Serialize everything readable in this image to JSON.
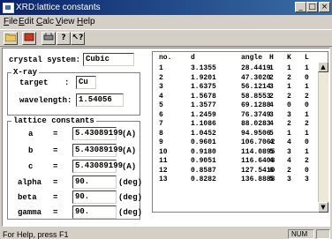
{
  "window": {
    "title": "XRD:lattice constants",
    "controls": [
      "minimize",
      "maximize",
      "close"
    ]
  },
  "menu": [
    "File",
    "Edit",
    "Calc",
    "View",
    "Help"
  ],
  "toolbar": {
    "buttons": [
      "folder-icon",
      "book-icon",
      "print-icon",
      "help-icon",
      "context-help-icon"
    ]
  },
  "crystal": {
    "label": "crystal system:",
    "value": "Cubic"
  },
  "xray": {
    "group_label": "X-ray",
    "target_label": "target",
    "target_colon": ":",
    "target_value": "Cu",
    "wavelength_label": "wavelength:",
    "wavelength_value": "1.54056"
  },
  "lattice": {
    "group_label": "lattice constants",
    "a_label": "a",
    "a_value": "5.43089199",
    "a_unit": "(A)",
    "b_label": "b",
    "b_value": "5.43089199",
    "b_unit": "(A)",
    "c_label": "c",
    "c_value": "5.43089199",
    "c_unit": "(A)",
    "alpha_label": "alpha",
    "alpha_value": "90.",
    "alpha_unit": "(deg)",
    "beta_label": "beta",
    "beta_value": "90.",
    "beta_unit": "(deg)",
    "gamma_label": "gamma",
    "gamma_value": "90.",
    "gamma_unit": "(deg)",
    "eq": "="
  },
  "table": {
    "headers": [
      "no.",
      "d",
      "angle",
      "H",
      "K",
      "L"
    ],
    "rows": [
      [
        "1",
        "3.1355",
        "28.4419",
        "1",
        "1",
        "1"
      ],
      [
        "2",
        "1.9201",
        "47.3020",
        "2",
        "2",
        "0"
      ],
      [
        "3",
        "1.6375",
        "56.1214",
        "3",
        "1",
        "1"
      ],
      [
        "4",
        "1.5678",
        "58.8553",
        "2",
        "2",
        "2"
      ],
      [
        "5",
        "1.3577",
        "69.1288",
        "4",
        "0",
        "0"
      ],
      [
        "6",
        "1.2459",
        "76.3749",
        "3",
        "3",
        "1"
      ],
      [
        "7",
        "1.1086",
        "88.0283",
        "4",
        "2",
        "2"
      ],
      [
        "8",
        "1.0452",
        "94.9506",
        "5",
        "1",
        "1"
      ],
      [
        "9",
        "0.9601",
        "106.7062",
        "4",
        "4",
        "0"
      ],
      [
        "10",
        "0.9180",
        "114.0895",
        "5",
        "3",
        "1"
      ],
      [
        "11",
        "0.9051",
        "116.6408",
        "4",
        "4",
        "2"
      ],
      [
        "12",
        "0.8587",
        "127.5410",
        "6",
        "2",
        "0"
      ],
      [
        "13",
        "0.8282",
        "136.8888",
        "5",
        "3",
        "3"
      ]
    ]
  },
  "status": {
    "help": "For Help, press F1",
    "num": "NUM"
  }
}
